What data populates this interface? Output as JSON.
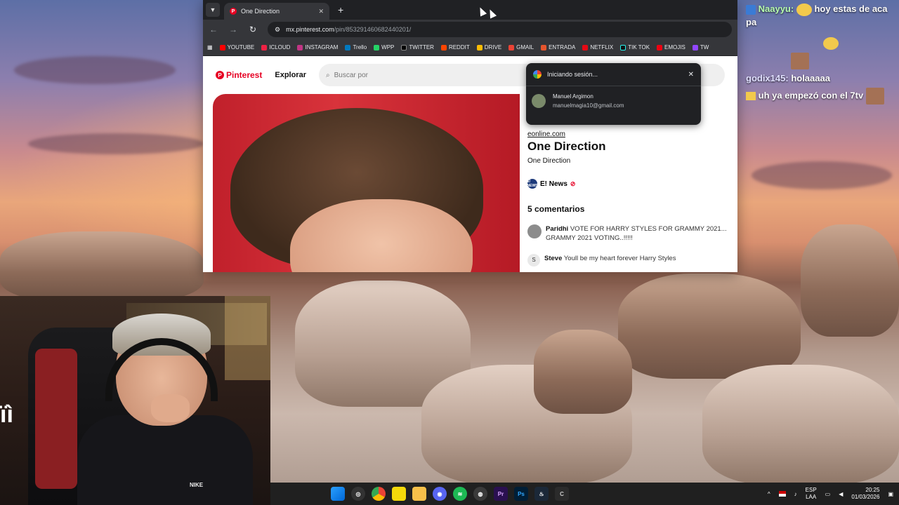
{
  "browser": {
    "tab_title": "One Direction",
    "tab_favicon": "P",
    "tab_close": "✕",
    "new_tab": "+",
    "url_domain": "mx.pinterest.com",
    "url_path": "/pin/853291460682440201/",
    "bookmarks": [
      "YOUTUBE",
      "ICLOUD",
      "INSTAGRAM",
      "Trello",
      "WPP",
      "TWITTER",
      "REDDIT",
      "DRIVE",
      "GMAIL",
      "ENTRADA",
      "NETFLIX",
      "TIK TOK",
      "EMOJIS",
      "TW"
    ]
  },
  "pinterest": {
    "logo": "Pinterest",
    "explore": "Explorar",
    "search_placeholder": "Buscar por",
    "source": "eonline.com",
    "title": "One Direction",
    "description": "One Direction",
    "creator": "E! News",
    "creator_avatar": "E! NEWS",
    "comments_title": "5 comentarios",
    "comments": [
      {
        "user": "Paridhi",
        "text": "VOTE FOR HARRY STYLES FOR GRAMMY 2021... GRAMMY 2021 VOTING..!!!!!"
      },
      {
        "user": "Steve",
        "avatar": "S",
        "text": "Youll be my heart forever Harry Styles"
      }
    ]
  },
  "google_popup": {
    "title": "Iniciando sesión...",
    "close": "✕",
    "account_name": "Manuel Argimon",
    "account_email": "manuelmagia10@gmail.com"
  },
  "chat": [
    {
      "user": "Naayyu:",
      "text": "hoy estas de aca pa"
    },
    {
      "user": "godix145:",
      "text": "holaaaaa"
    },
    {
      "user": "",
      "text": "uh ya empezó con el 7tv"
    }
  ],
  "webcam": {
    "shirt_logo": "NIKE",
    "side_logo": "ïì"
  },
  "taskbar": {
    "lang_top": "ESP",
    "lang_bottom": "LAA",
    "time": "20:25",
    "date": "01/03/2026"
  },
  "colors": {
    "pinterest_red": "#e60023",
    "chrome_dark": "#202124",
    "taskbar": "#202020"
  }
}
